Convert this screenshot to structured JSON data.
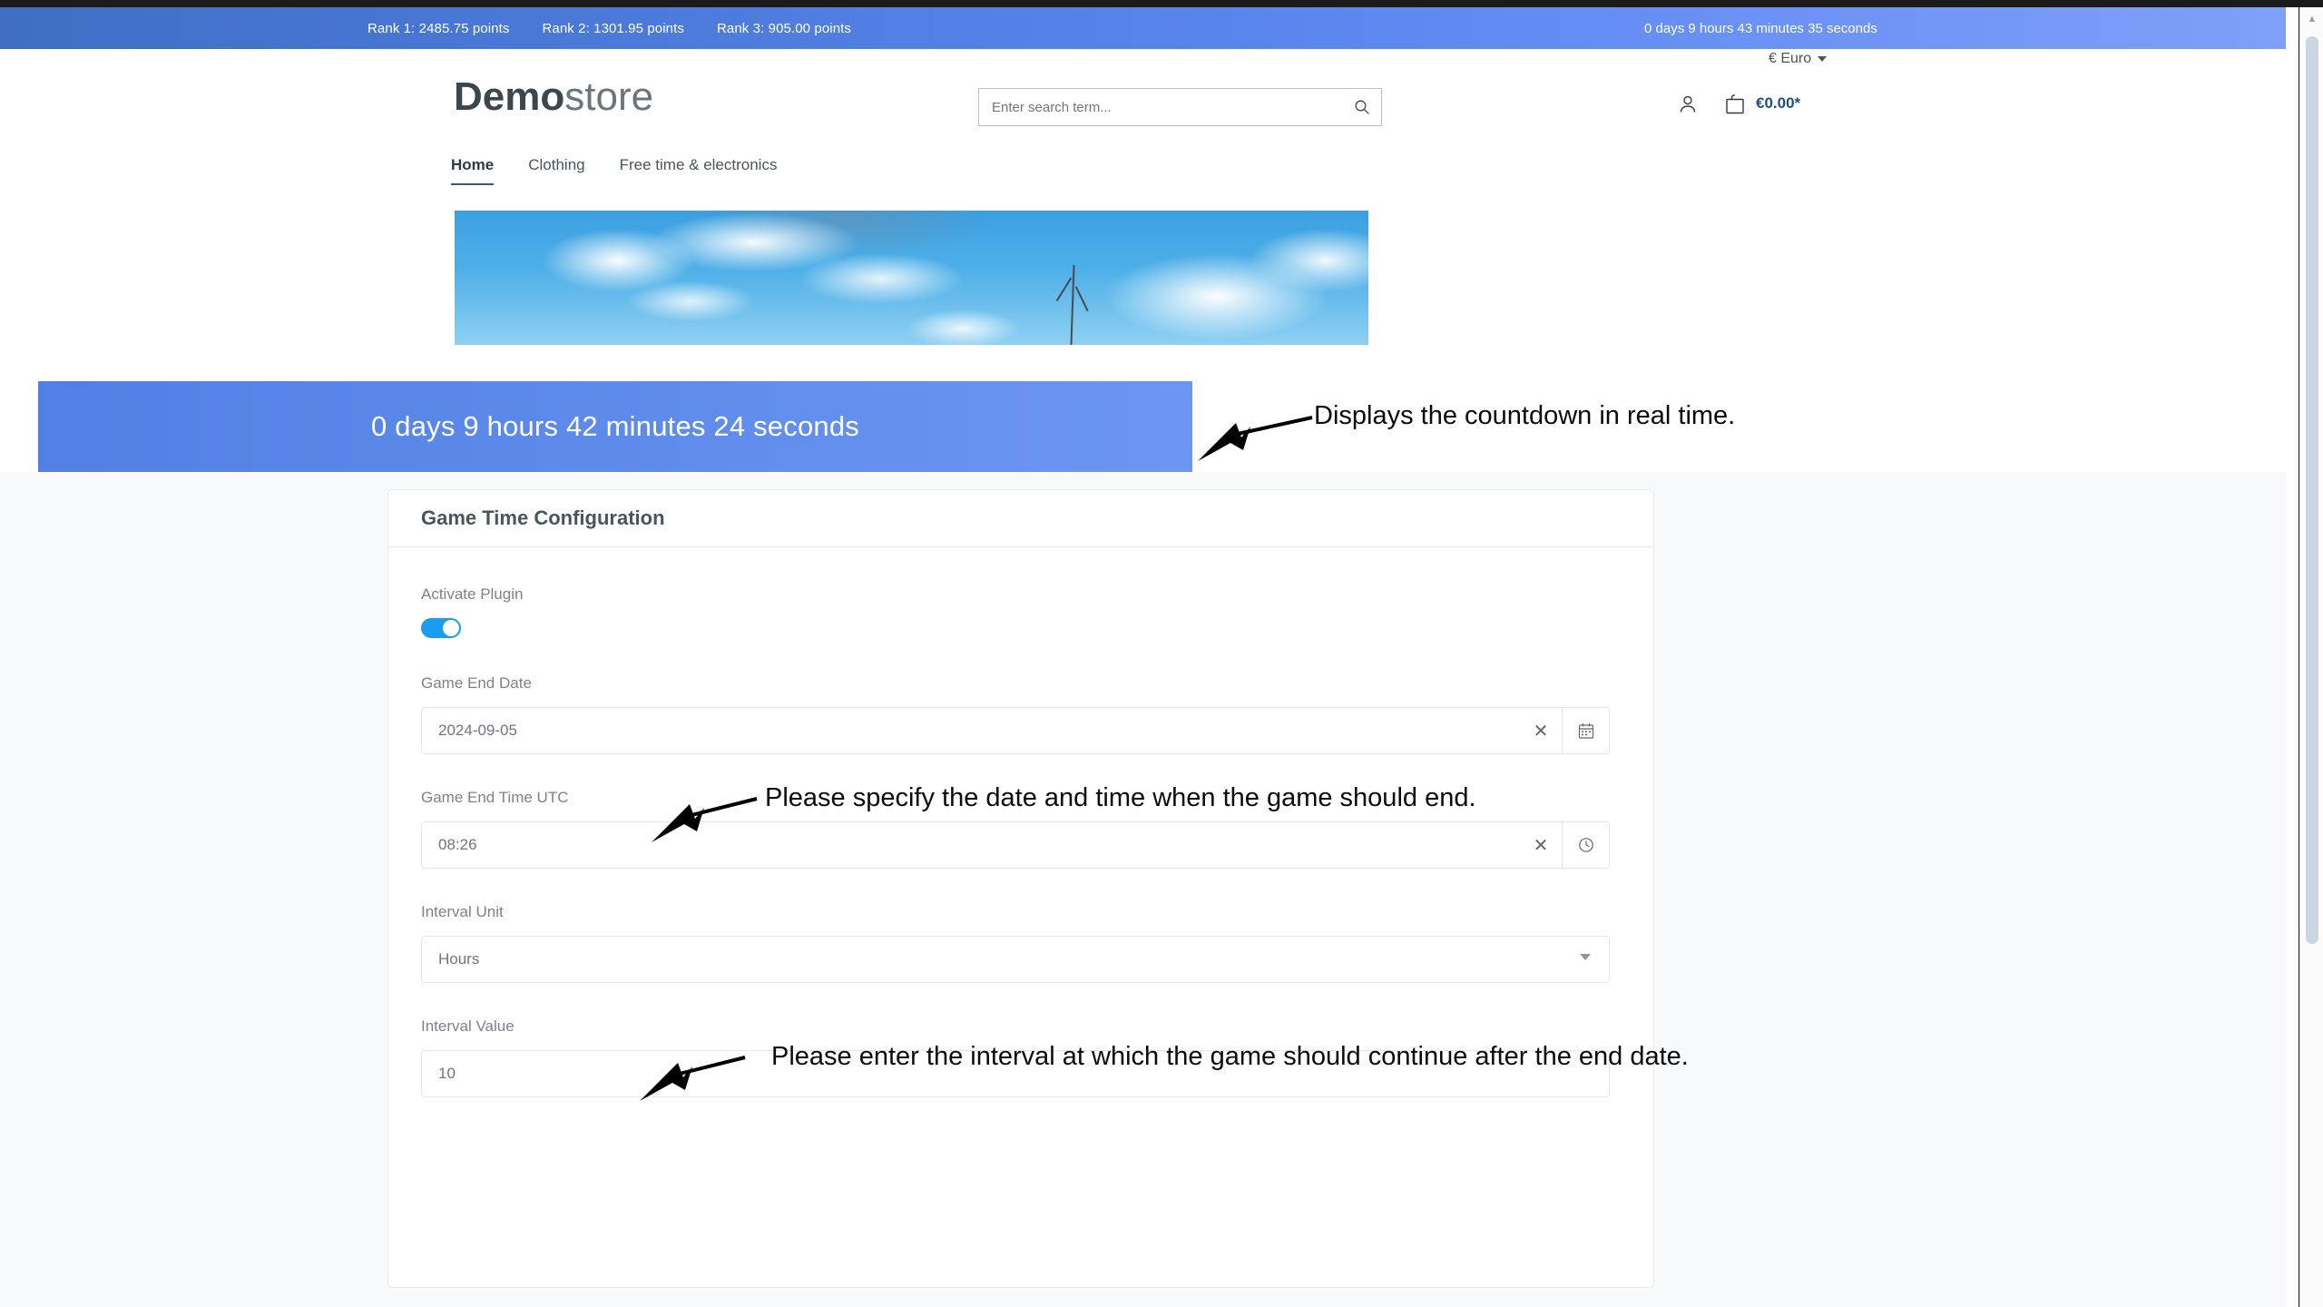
{
  "top_bar": {
    "ranks": [
      "Rank 1: 2485.75 points",
      "Rank 2: 1301.95 points",
      "Rank 3: 905.00 points"
    ],
    "countdown": "0 days 9 hours 43 minutes 35 seconds",
    "background_color": "#5b87ee"
  },
  "shop_header": {
    "currency": "€ Euro",
    "logo_bold": "Demo",
    "logo_normal": "store",
    "search_placeholder": "Enter search term...",
    "search_value": "",
    "cart_total": "€0.00*",
    "cart_color": "#1f4f82"
  },
  "nav": {
    "items": [
      {
        "label": "Home",
        "active": true
      },
      {
        "label": "Clothing",
        "active": false
      },
      {
        "label": "Free time & electronics",
        "active": false
      }
    ]
  },
  "banner": {
    "countdown": "0 days 9 hours 42 minutes 24 seconds",
    "background_color": "#5d89ea"
  },
  "card": {
    "title": "Game Time Configuration",
    "fields": {
      "activate_plugin_label": "Activate Plugin",
      "activate_plugin_state": "on",
      "game_end_date_label": "Game End Date",
      "game_end_date_value": "2024-09-05",
      "game_end_time_label": "Game End Time UTC",
      "game_end_time_value": "08:26",
      "interval_unit_label": "Interval Unit",
      "interval_unit_value": "Hours",
      "interval_value_label": "Interval Value",
      "interval_value_value": "10"
    }
  },
  "annotations": [
    "Displays the countdown in real time.",
    "Please specify the date and time when the game should end.",
    "Please enter the interval at which the game should continue after the end date."
  ]
}
